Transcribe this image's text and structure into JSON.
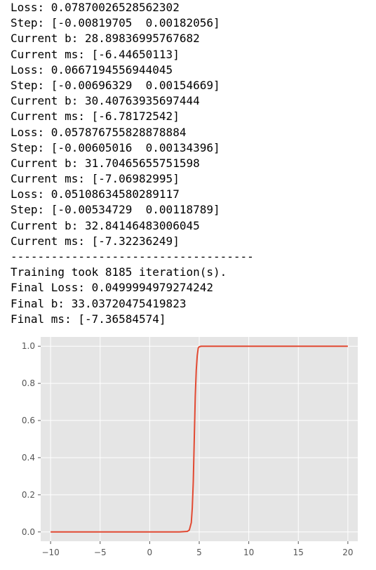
{
  "console_lines": [
    "Loss: 0.07870026528562302",
    "Step: [-0.00819705  0.00182056]",
    "Current b: 28.89836995767682",
    "Current ms: [-6.44650113]",
    "Loss: 0.0667194556944045",
    "Step: [-0.00696329  0.00154669]",
    "Current b: 30.40763935697444",
    "Current ms: [-6.78172542]",
    "Loss: 0.057876755828878884",
    "Step: [-0.00605016  0.00134396]",
    "Current b: 31.70465655751598",
    "Current ms: [-7.06982995]",
    "Loss: 0.05108634580289117",
    "Step: [-0.00534729  0.00118789]",
    "Current b: 32.84146483006045",
    "Current ms: [-7.32236249]",
    "------------------------------------",
    "Training took 8185 iteration(s).",
    "Final Loss: 0.0499994979274242",
    "Final b: 33.03720475419823",
    "Final ms: [-7.36584574]"
  ],
  "colors": {
    "plot_background": "#e5e5e5",
    "grid": "#ffffff",
    "line": "#e24a33",
    "tick_label": "#555555"
  },
  "chart_data": {
    "type": "line",
    "style": "ggplot",
    "xlim": [
      -11,
      21
    ],
    "ylim": [
      -0.05,
      1.05
    ],
    "xticks": [
      -10,
      -5,
      0,
      5,
      10,
      15,
      20
    ],
    "xtick_labels": [
      "−10",
      "−5",
      "0",
      "5",
      "10",
      "15",
      "20"
    ],
    "yticks": [
      0.0,
      0.2,
      0.4,
      0.6,
      0.8,
      1.0
    ],
    "ytick_labels": [
      "0.0",
      "0.2",
      "0.4",
      "0.6",
      "0.8",
      "1.0"
    ],
    "grid": true,
    "series": [
      {
        "x": [
          -10,
          -5,
          0,
          3,
          3.8,
          4.0,
          4.2,
          4.3,
          4.4,
          4.5,
          4.6,
          4.7,
          4.8,
          4.9,
          5.0,
          5.2,
          5.5,
          10,
          15,
          20
        ],
        "y": [
          0.0,
          0.0,
          0.0,
          0.0,
          0.003,
          0.01,
          0.05,
          0.13,
          0.27,
          0.5,
          0.73,
          0.87,
          0.95,
          0.99,
          0.997,
          1.0,
          1.0,
          1.0,
          1.0,
          1.0
        ]
      }
    ]
  }
}
